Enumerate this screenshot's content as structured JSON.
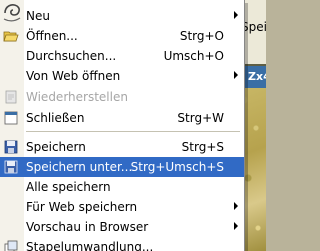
{
  "background": {
    "toolbar_label": "Spei",
    "tab_label": "Zx4"
  },
  "menu": {
    "items": [
      {
        "label": "Neu",
        "mnemonic": "N",
        "shortcut": "",
        "submenu": true,
        "icon": "new-icon",
        "disabled": false
      },
      {
        "label": "Öffnen...",
        "mnemonic": "Ö",
        "shortcut": "Strg+O",
        "submenu": false,
        "icon": "open-folder-icon",
        "disabled": false
      },
      {
        "label": "Durchsuchen...",
        "mnemonic": "D",
        "shortcut": "Umsch+O",
        "submenu": false,
        "icon": "",
        "disabled": false
      },
      {
        "label": "Von Web öffnen",
        "mnemonic": "V",
        "shortcut": "",
        "submenu": true,
        "icon": "",
        "disabled": false
      },
      {
        "label": "Wiederherstellen",
        "mnemonic": "W",
        "shortcut": "",
        "submenu": false,
        "icon": "revert-icon",
        "disabled": true
      },
      {
        "label": "Schließen",
        "mnemonic": "S",
        "shortcut": "Strg+W",
        "submenu": false,
        "icon": "close-doc-icon",
        "disabled": false
      },
      {
        "label": "Speichern",
        "mnemonic": "S",
        "shortcut": "Strg+S",
        "submenu": false,
        "icon": "save-icon",
        "disabled": false
      },
      {
        "label": "Speichern unter...",
        "mnemonic": "u",
        "shortcut": "Strg+Umsch+S",
        "submenu": false,
        "icon": "save-as-icon",
        "disabled": false,
        "selected": true
      },
      {
        "label": "Alle speichern",
        "mnemonic": "A",
        "shortcut": "",
        "submenu": false,
        "icon": "",
        "disabled": false
      },
      {
        "label": "Für Web speichern",
        "mnemonic": "F",
        "shortcut": "",
        "submenu": true,
        "icon": "",
        "disabled": false
      },
      {
        "label": "Vorschau in Browser",
        "mnemonic": "V",
        "shortcut": "",
        "submenu": true,
        "icon": "",
        "disabled": false
      },
      {
        "label": "Stapelumwandlung...",
        "mnemonic": "u",
        "shortcut": "",
        "submenu": false,
        "icon": "batch-icon",
        "disabled": false
      }
    ]
  },
  "colors": {
    "highlight": "#316ac5",
    "menu_bg": "#ffffff",
    "disabled_text": "#a6a6a6"
  }
}
